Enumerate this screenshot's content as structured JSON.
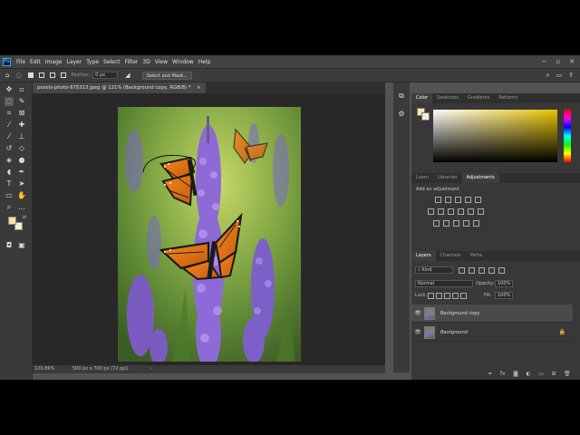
{
  "menu": {
    "logo": "Ps",
    "items": [
      "File",
      "Edit",
      "Image",
      "Layer",
      "Type",
      "Select",
      "Filter",
      "3D",
      "View",
      "Window",
      "Help"
    ]
  },
  "options": {
    "feather_label": "Feather:",
    "feather_value": "0 px",
    "select_mask": "Select and Mask..."
  },
  "document": {
    "tab_title": "pexels-photo-675313.jpeg @ 121% (Background copy, RGB/8) *",
    "close": "×",
    "zoom": "120.86%",
    "dims": "500 px x 700 px (72 ppi)",
    "arrow": "›"
  },
  "color_panel": {
    "tabs": [
      "Color",
      "Swatches",
      "Gradients",
      "Patterns"
    ],
    "fg": "#f5e7a0",
    "bg": "#f3efd6"
  },
  "adjustments_panel": {
    "tabs": [
      "Learn",
      "Libraries",
      "Adjustments"
    ],
    "add_label": "Add an adjustment"
  },
  "layers_panel": {
    "tabs": [
      "Layers",
      "Channels",
      "Paths"
    ],
    "kind": "Kind",
    "blend_mode": "Normal",
    "opacity_label": "Opacity:",
    "opacity_value": "100%",
    "lock_label": "Lock:",
    "fill_label": "Fill:",
    "fill_value": "100%",
    "layers": [
      {
        "name": "Background copy",
        "selected": true
      },
      {
        "name": "Background",
        "selected": false
      }
    ]
  }
}
